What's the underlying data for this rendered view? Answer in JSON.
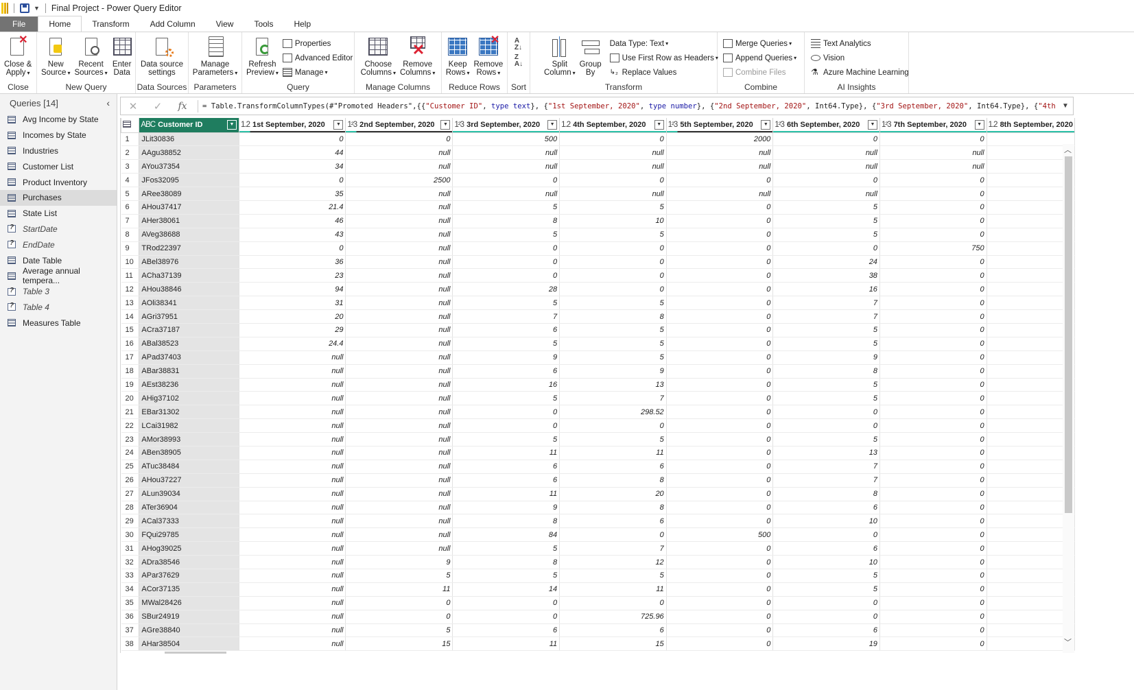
{
  "app": {
    "title": "Final Project - Power Query Editor"
  },
  "tabs": [
    "File",
    "Home",
    "Transform",
    "Add Column",
    "View",
    "Tools",
    "Help"
  ],
  "ribbon": {
    "close": {
      "close_apply": "Close &",
      "close_apply2": "Apply",
      "label": "Close"
    },
    "new_query": {
      "new_source": "New",
      "new_source2": "Source",
      "recent_sources": "Recent",
      "recent_sources2": "Sources",
      "enter_data": "Enter",
      "enter_data2": "Data",
      "label": "New Query"
    },
    "data_sources": {
      "settings": "Data source",
      "settings2": "settings",
      "label": "Data Sources"
    },
    "parameters": {
      "manage": "Manage",
      "manage2": "Parameters",
      "label": "Parameters"
    },
    "query": {
      "refresh": "Refresh",
      "refresh2": "Preview",
      "properties": "Properties",
      "advanced_editor": "Advanced Editor",
      "manage": "Manage",
      "label": "Query"
    },
    "manage_columns": {
      "choose": "Choose",
      "choose2": "Columns",
      "remove": "Remove",
      "remove2": "Columns",
      "label": "Manage Columns"
    },
    "reduce_rows": {
      "keep": "Keep",
      "keep2": "Rows",
      "remove": "Remove",
      "remove2": "Rows",
      "label": "Reduce Rows"
    },
    "sort": {
      "label": "Sort"
    },
    "transform": {
      "split": "Split",
      "split2": "Column",
      "group": "Group",
      "group2": "By",
      "data_type": "Data Type: Text",
      "first_row": "Use First Row as Headers",
      "replace": "Replace Values",
      "label": "Transform"
    },
    "combine": {
      "merge": "Merge Queries",
      "append": "Append Queries",
      "combine_files": "Combine Files",
      "label": "Combine"
    },
    "ai": {
      "text_analytics": "Text Analytics",
      "vision": "Vision",
      "azure_ml": "Azure Machine Learning",
      "label": "AI Insights"
    }
  },
  "sidebar": {
    "header": "Queries [14]",
    "items": [
      {
        "label": "Avg Income by State",
        "type": "table"
      },
      {
        "label": "Incomes by State",
        "type": "table"
      },
      {
        "label": "Industries",
        "type": "table"
      },
      {
        "label": "Customer List",
        "type": "table"
      },
      {
        "label": "Product Inventory",
        "type": "table"
      },
      {
        "label": "Purchases",
        "type": "table",
        "selected": true
      },
      {
        "label": "State List",
        "type": "table"
      },
      {
        "label": "StartDate",
        "type": "param"
      },
      {
        "label": "EndDate",
        "type": "param"
      },
      {
        "label": "Date Table",
        "type": "table"
      },
      {
        "label": "Average annual tempera...",
        "type": "table"
      },
      {
        "label": "Table 3",
        "type": "param"
      },
      {
        "label": "Table 4",
        "type": "param"
      },
      {
        "label": "Measures Table",
        "type": "table"
      }
    ]
  },
  "formula": {
    "p1": "= Table.TransformColumnTypes(#\"Promoted Headers\",{{",
    "s1": "\"Customer ID\"",
    "p2": ", ",
    "k1": "type text",
    "p3": "}, {",
    "s2": "\"1st September, 2020\"",
    "p4": ", ",
    "k2": "type number",
    "p5": "}, {",
    "s3": "\"2nd September, 2020\"",
    "p6": ", Int64.Type}, {",
    "s4": "\"3rd September, 2020\"",
    "p7": ", Int64.Type}, {",
    "s5": "\"4th"
  },
  "columns": [
    {
      "type": "ABC",
      "name": "Customer ID"
    },
    {
      "type": "1.2",
      "name": "1st September, 2020"
    },
    {
      "type": "1²3",
      "name": "2nd September, 2020"
    },
    {
      "type": "1²3",
      "name": "3rd September, 2020"
    },
    {
      "type": "1.2",
      "name": "4th September, 2020"
    },
    {
      "type": "1²3",
      "name": "5th September, 2020"
    },
    {
      "type": "1²3",
      "name": "6th September, 2020"
    },
    {
      "type": "1²3",
      "name": "7th September, 2020"
    },
    {
      "type": "1.2",
      "name": "8th September, 2020"
    }
  ],
  "rows": [
    [
      "JLit30836",
      "0",
      "0",
      "500",
      "0",
      "2000",
      "0",
      "0"
    ],
    [
      "AAgu38852",
      "44",
      "null",
      "null",
      "null",
      "null",
      "null",
      "null"
    ],
    [
      "AYou37354",
      "34",
      "null",
      "null",
      "null",
      "null",
      "null",
      "null"
    ],
    [
      "JFos32095",
      "0",
      "2500",
      "0",
      "0",
      "0",
      "0",
      "0"
    ],
    [
      "ARee38089",
      "35",
      "null",
      "null",
      "null",
      "null",
      "null",
      "0"
    ],
    [
      "AHou37417",
      "21.4",
      "null",
      "5",
      "5",
      "0",
      "5",
      "0"
    ],
    [
      "AHer38061",
      "46",
      "null",
      "8",
      "10",
      "0",
      "5",
      "0"
    ],
    [
      "AVeg38688",
      "43",
      "null",
      "5",
      "5",
      "0",
      "5",
      "0"
    ],
    [
      "TRod22397",
      "0",
      "null",
      "0",
      "0",
      "0",
      "0",
      "750"
    ],
    [
      "ABel38976",
      "36",
      "null",
      "0",
      "0",
      "0",
      "24",
      "0"
    ],
    [
      "ACha37139",
      "23",
      "null",
      "0",
      "0",
      "0",
      "38",
      "0"
    ],
    [
      "AHou38846",
      "94",
      "null",
      "28",
      "0",
      "0",
      "16",
      "0"
    ],
    [
      "AOli38341",
      "31",
      "null",
      "5",
      "5",
      "0",
      "7",
      "0"
    ],
    [
      "AGri37951",
      "20",
      "null",
      "7",
      "8",
      "0",
      "7",
      "0"
    ],
    [
      "ACra37187",
      "29",
      "null",
      "6",
      "5",
      "0",
      "5",
      "0"
    ],
    [
      "ABal38523",
      "24.4",
      "null",
      "5",
      "5",
      "0",
      "5",
      "0"
    ],
    [
      "APad37403",
      "null",
      "null",
      "9",
      "5",
      "0",
      "9",
      "0"
    ],
    [
      "ABar38831",
      "null",
      "null",
      "6",
      "9",
      "0",
      "8",
      "0"
    ],
    [
      "AEst38236",
      "null",
      "null",
      "16",
      "13",
      "0",
      "5",
      "0"
    ],
    [
      "AHig37102",
      "null",
      "null",
      "5",
      "7",
      "0",
      "5",
      "0"
    ],
    [
      "EBar31302",
      "null",
      "null",
      "0",
      "298.52",
      "0",
      "0",
      "0"
    ],
    [
      "LCai31982",
      "null",
      "null",
      "0",
      "0",
      "0",
      "0",
      "0"
    ],
    [
      "AMor38993",
      "null",
      "null",
      "5",
      "5",
      "0",
      "5",
      "0"
    ],
    [
      "ABen38905",
      "null",
      "null",
      "11",
      "11",
      "0",
      "13",
      "0"
    ],
    [
      "ATuc38484",
      "null",
      "null",
      "6",
      "6",
      "0",
      "7",
      "0"
    ],
    [
      "AHou37227",
      "null",
      "null",
      "6",
      "8",
      "0",
      "7",
      "0"
    ],
    [
      "ALun39034",
      "null",
      "null",
      "11",
      "20",
      "0",
      "8",
      "0"
    ],
    [
      "ATer36904",
      "null",
      "null",
      "9",
      "8",
      "0",
      "6",
      "0"
    ],
    [
      "ACal37333",
      "null",
      "null",
      "8",
      "6",
      "0",
      "10",
      "0"
    ],
    [
      "FQui29785",
      "null",
      "null",
      "84",
      "0",
      "500",
      "0",
      "0"
    ],
    [
      "AHog39025",
      "null",
      "null",
      "5",
      "7",
      "0",
      "6",
      "0"
    ],
    [
      "ADra38546",
      "null",
      "9",
      "8",
      "12",
      "0",
      "10",
      "0"
    ],
    [
      "APar37629",
      "null",
      "5",
      "5",
      "5",
      "0",
      "5",
      "0"
    ],
    [
      "ACor37135",
      "null",
      "11",
      "14",
      "11",
      "0",
      "5",
      "0"
    ],
    [
      "MWal28426",
      "null",
      "0",
      "0",
      "0",
      "0",
      "0",
      "0"
    ],
    [
      "SBur24919",
      "null",
      "0",
      "0",
      "725.96",
      "0",
      "0",
      "0"
    ],
    [
      "AGre38840",
      "null",
      "5",
      "6",
      "6",
      "0",
      "6",
      "0"
    ],
    [
      "AHar38504",
      "null",
      "15",
      "11",
      "15",
      "0",
      "19",
      "0"
    ]
  ]
}
